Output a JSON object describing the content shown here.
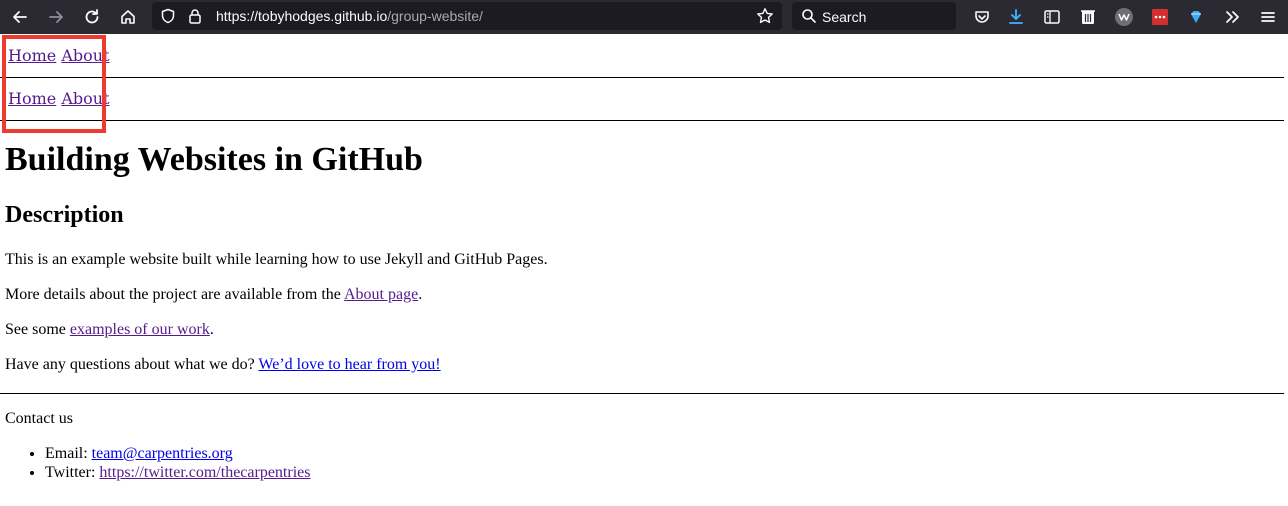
{
  "browser": {
    "url_host": "https://tobyhodges.github.io",
    "url_path": "/group-website/",
    "search_placeholder": "Search",
    "colors": {
      "toolbar_bg": "#2b2a33",
      "field_bg": "#1c1b22",
      "download_icon": "#40b4ff",
      "ext_red": "#d32f2f"
    },
    "icons": [
      "back-icon",
      "forward-icon",
      "reload-icon",
      "home-icon",
      "shield-icon",
      "lock-icon",
      "bookmark-star-icon",
      "search-icon",
      "pocket-icon",
      "download-icon",
      "reader-view-icon",
      "trash-extension-icon",
      "wappalyzer-extension-icon",
      "dots-extension-icon",
      "gem-extension-icon",
      "overflow-chevrons-icon",
      "menu-icon"
    ]
  },
  "nav": [
    {
      "home": "Home",
      "about": "About"
    },
    {
      "home": "Home",
      "about": "About"
    }
  ],
  "highlight_color": "#ee3b30",
  "page": {
    "title": "Building Websites in GitHub",
    "section_heading": "Description",
    "p1": "This is an example website built while learning how to use Jekyll and GitHub Pages.",
    "p2_prefix": "More details about the project are available from the ",
    "p2_link": "About page",
    "p2_suffix": ".",
    "p3_prefix": "See some ",
    "p3_link": "examples of our work",
    "p3_suffix": ".",
    "p4_prefix": "Have any questions about what we do? ",
    "p4_link": "We’d love to hear from you!"
  },
  "footer": {
    "heading": "Contact us",
    "email_label": "Email: ",
    "email": "team@carpentries.org",
    "twitter_label": "Twitter: ",
    "twitter": "https://twitter.com/thecarpentries"
  }
}
